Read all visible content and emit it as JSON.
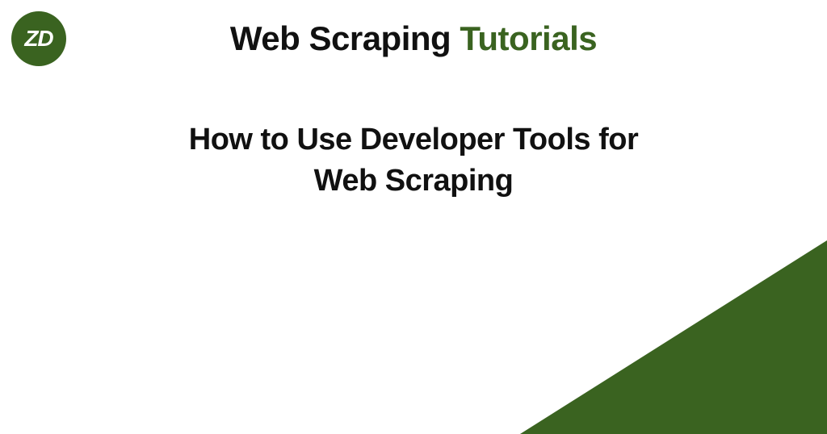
{
  "logo": {
    "text": "ZD"
  },
  "header": {
    "part1": "Web Scraping ",
    "part2": "Tutorials"
  },
  "main": {
    "line1": "How to Use Developer Tools for",
    "line2": "Web Scraping"
  },
  "colors": {
    "brand_green": "#3a6320",
    "text_dark": "#111111"
  }
}
